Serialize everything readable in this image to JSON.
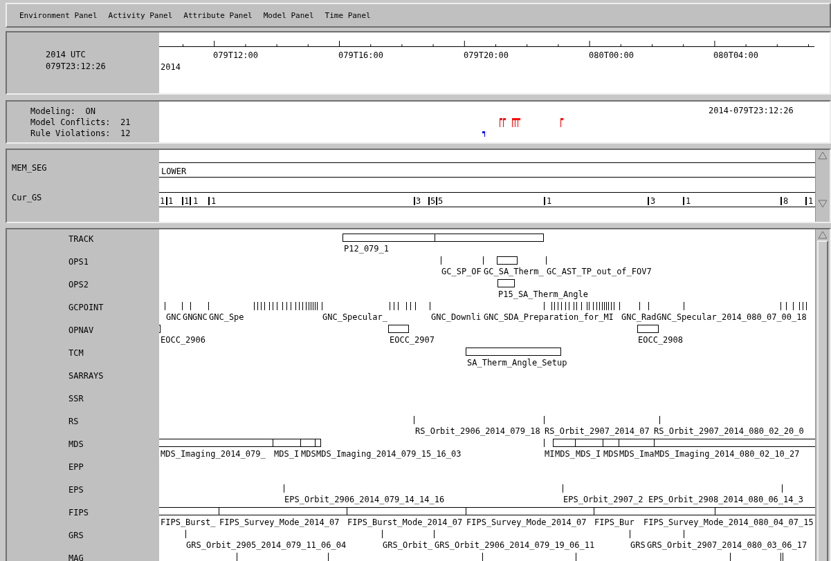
{
  "menu": [
    "Environment Panel",
    "Activity Panel",
    "Attribute Panel",
    "Model Panel",
    "Time Panel"
  ],
  "time_panel": {
    "zone_label": "2014 UTC",
    "current_time": "079T23:12:26",
    "axis_labels": [
      "079T12:00",
      "079T16:00",
      "079T20:00",
      "080T00:00",
      "080T04:00"
    ],
    "year": "2014"
  },
  "status_panel": {
    "lines": [
      "Modeling:  ON",
      "Model Conflicts:  21",
      "Rule Violations:  12"
    ],
    "timestamp": "2014-079T23:12:26",
    "flags": [
      {
        "color": "#ff0000"
      },
      {
        "color": "#ff0000"
      },
      {
        "color": "#ff0000"
      },
      {
        "color": "#ff0000"
      },
      {
        "color": "#ff0000"
      },
      {
        "color": "#ff0000"
      },
      {
        "color": "#0000ff"
      }
    ]
  },
  "state_rows": [
    {
      "name": "MEM_SEG",
      "values": [
        {
          "kind": "continued",
          "label": "LOWER"
        }
      ]
    },
    {
      "name": "Cur_GS",
      "values": [
        {
          "kind": "continued",
          "label": "1"
        },
        {
          "kind": "change",
          "label": "1"
        },
        {
          "kind": "change",
          "label": "1"
        },
        {
          "kind": "change",
          "label": "1"
        },
        {
          "kind": "change",
          "label": "1"
        },
        {
          "kind": "change",
          "label": "3"
        },
        {
          "kind": "change",
          "label": "5"
        },
        {
          "kind": "change",
          "label": "5"
        },
        {
          "kind": "change",
          "label": "1"
        },
        {
          "kind": "change",
          "label": "3"
        },
        {
          "kind": "change",
          "label": "1"
        },
        {
          "kind": "change",
          "label": "8"
        },
        {
          "kind": "change",
          "label": "1"
        }
      ]
    }
  ],
  "activity_rows": [
    {
      "name": "TRACK",
      "items": [
        {
          "kind": "segment",
          "label": "P12_079_1"
        },
        {
          "kind": "segment"
        }
      ]
    },
    {
      "name": "OPS1",
      "items": [
        {
          "kind": "tick",
          "label": "GC_SP_OF"
        },
        {
          "kind": "tick",
          "label": "GC_SA_Therm_"
        },
        {
          "kind": "segment"
        },
        {
          "kind": "tick",
          "label": "GC_AST_TP_out_of_FOV7"
        }
      ]
    },
    {
      "name": "OPS2",
      "items": [
        {
          "kind": "segment",
          "label": "P15_SA_Therm_Angle"
        }
      ]
    },
    {
      "name": "GCPOINT",
      "items": [
        {
          "kind": "tick",
          "label": "GNC"
        },
        {
          "kind": "tick",
          "label": "GN"
        },
        {
          "kind": "tick",
          "label": "GNC"
        },
        {
          "kind": "tick",
          "label": "GNC_Spe"
        },
        {
          "kind": "tick"
        },
        {
          "kind": "tick"
        },
        {
          "kind": "tick"
        },
        {
          "kind": "tick"
        },
        {
          "kind": "tick"
        },
        {
          "kind": "tick"
        },
        {
          "kind": "tick"
        },
        {
          "kind": "tick"
        },
        {
          "kind": "tick"
        },
        {
          "kind": "tick"
        },
        {
          "kind": "tick"
        },
        {
          "kind": "tick"
        },
        {
          "kind": "tick"
        },
        {
          "kind": "tick"
        },
        {
          "kind": "tick"
        },
        {
          "kind": "tick"
        },
        {
          "kind": "tick"
        },
        {
          "kind": "tick"
        },
        {
          "kind": "tick"
        },
        {
          "kind": "tick",
          "label": "GNC_Specular_"
        },
        {
          "kind": "tick"
        },
        {
          "kind": "tick"
        },
        {
          "kind": "tick"
        },
        {
          "kind": "tick"
        },
        {
          "kind": "tick"
        },
        {
          "kind": "tick"
        },
        {
          "kind": "tick",
          "label": "GNC_Downli"
        },
        {
          "kind": "label",
          "label": "GNC_SDA_Preparation_for_MI"
        },
        {
          "kind": "label",
          "label": "GNC_Rad"
        },
        {
          "kind": "label",
          "label": "GNC_Specular_2014_080_07_00_18"
        },
        {
          "kind": "tick"
        },
        {
          "kind": "tick"
        },
        {
          "kind": "tick"
        },
        {
          "kind": "tick"
        },
        {
          "kind": "tick"
        },
        {
          "kind": "tick"
        },
        {
          "kind": "tick"
        },
        {
          "kind": "tick"
        },
        {
          "kind": "tick"
        },
        {
          "kind": "tick"
        },
        {
          "kind": "tick"
        },
        {
          "kind": "tick"
        },
        {
          "kind": "tick"
        },
        {
          "kind": "tick"
        },
        {
          "kind": "tick"
        },
        {
          "kind": "tick"
        },
        {
          "kind": "tick"
        },
        {
          "kind": "tick"
        },
        {
          "kind": "tick"
        },
        {
          "kind": "tick"
        },
        {
          "kind": "tick"
        },
        {
          "kind": "tick"
        },
        {
          "kind": "tick"
        },
        {
          "kind": "tick"
        },
        {
          "kind": "tick"
        },
        {
          "kind": "tick"
        },
        {
          "kind": "tick"
        },
        {
          "kind": "tick"
        },
        {
          "kind": "tick"
        },
        {
          "kind": "tick"
        },
        {
          "kind": "tick"
        }
      ]
    },
    {
      "name": "OPNAV",
      "items": [
        {
          "kind": "segment",
          "label": "EOCC_2906"
        },
        {
          "kind": "segment",
          "label": "EOCC_2907"
        },
        {
          "kind": "segment",
          "label": "EOCC_2908"
        }
      ]
    },
    {
      "name": "TCM",
      "items": [
        {
          "kind": "segment",
          "label": "SA_Therm_Angle_Setup"
        }
      ]
    },
    {
      "name": "SARRAYS",
      "items": []
    },
    {
      "name": "SSR",
      "items": []
    },
    {
      "name": "RS",
      "items": [
        {
          "kind": "tick",
          "label": "RS_Orbit_2906_2014_079_18"
        },
        {
          "kind": "tick",
          "label": "RS_Orbit_2907_2014_07"
        },
        {
          "kind": "tick",
          "label": "RS_Orbit_2907_2014_080_02_20_0"
        }
      ]
    },
    {
      "name": "MDS",
      "items": [
        {
          "kind": "segment",
          "label": "MDS_Imaging_2014_079_"
        },
        {
          "kind": "segment",
          "label": "MDS_I"
        },
        {
          "kind": "segment",
          "label": "MDS"
        },
        {
          "kind": "segment",
          "label": "MDS_Imaging_2014_079_15_16_03"
        },
        {
          "kind": "tick",
          "label": "MI"
        },
        {
          "kind": "segment",
          "label": "MDS_"
        },
        {
          "kind": "segment",
          "label": "MDS_I"
        },
        {
          "kind": "segment",
          "label": "MDS"
        },
        {
          "kind": "segment",
          "label": "MDS_Ima"
        },
        {
          "kind": "segment",
          "label": "MDS_Imaging_2014_080_02_10_27"
        }
      ]
    },
    {
      "name": "EPP",
      "items": []
    },
    {
      "name": "EPS",
      "items": [
        {
          "kind": "tick",
          "label": "EPS_Orbit_2906_2014_079_14_14_16"
        },
        {
          "kind": "tick",
          "label": "EPS_Orbit_2907_2"
        },
        {
          "kind": "tick",
          "label": "EPS_Orbit_2908_2014_080_06_14_3"
        }
      ]
    },
    {
      "name": "FIPS",
      "items": [
        {
          "kind": "segment",
          "label": "FIPS_Burst_"
        },
        {
          "kind": "segment",
          "label": "FIPS_Survey_Mode_2014_07"
        },
        {
          "kind": "segment",
          "label": "FIPS_Burst_Mode_2014_07"
        },
        {
          "kind": "segment",
          "label": "FIPS_Survey_Mode_2014_07"
        },
        {
          "kind": "segment",
          "label": "FIPS_Bur"
        },
        {
          "kind": "segment"
        },
        {
          "kind": "label",
          "label": "FIPS_Survey_Mode_2014_080_04_07_15"
        }
      ]
    },
    {
      "name": "GRS",
      "items": [
        {
          "kind": "tick",
          "label": "GRS_Orbit_2905_2014_079_11_06_04"
        },
        {
          "kind": "tick",
          "label": "GRS_Orbit_"
        },
        {
          "kind": "tick",
          "label": "GRS_Orbit_2906_2014_079_19_06_11"
        },
        {
          "kind": "tick",
          "label": "GRS"
        },
        {
          "kind": "tick",
          "label": "GRS_Orbit_2907_2014_080_03_06_17"
        }
      ]
    },
    {
      "name": "MAG",
      "items": [
        {
          "kind": "tick"
        },
        {
          "kind": "tick"
        },
        {
          "kind": "tick"
        },
        {
          "kind": "tick"
        },
        {
          "kind": "tick"
        },
        {
          "kind": "tick"
        },
        {
          "kind": "tick"
        }
      ]
    }
  ]
}
